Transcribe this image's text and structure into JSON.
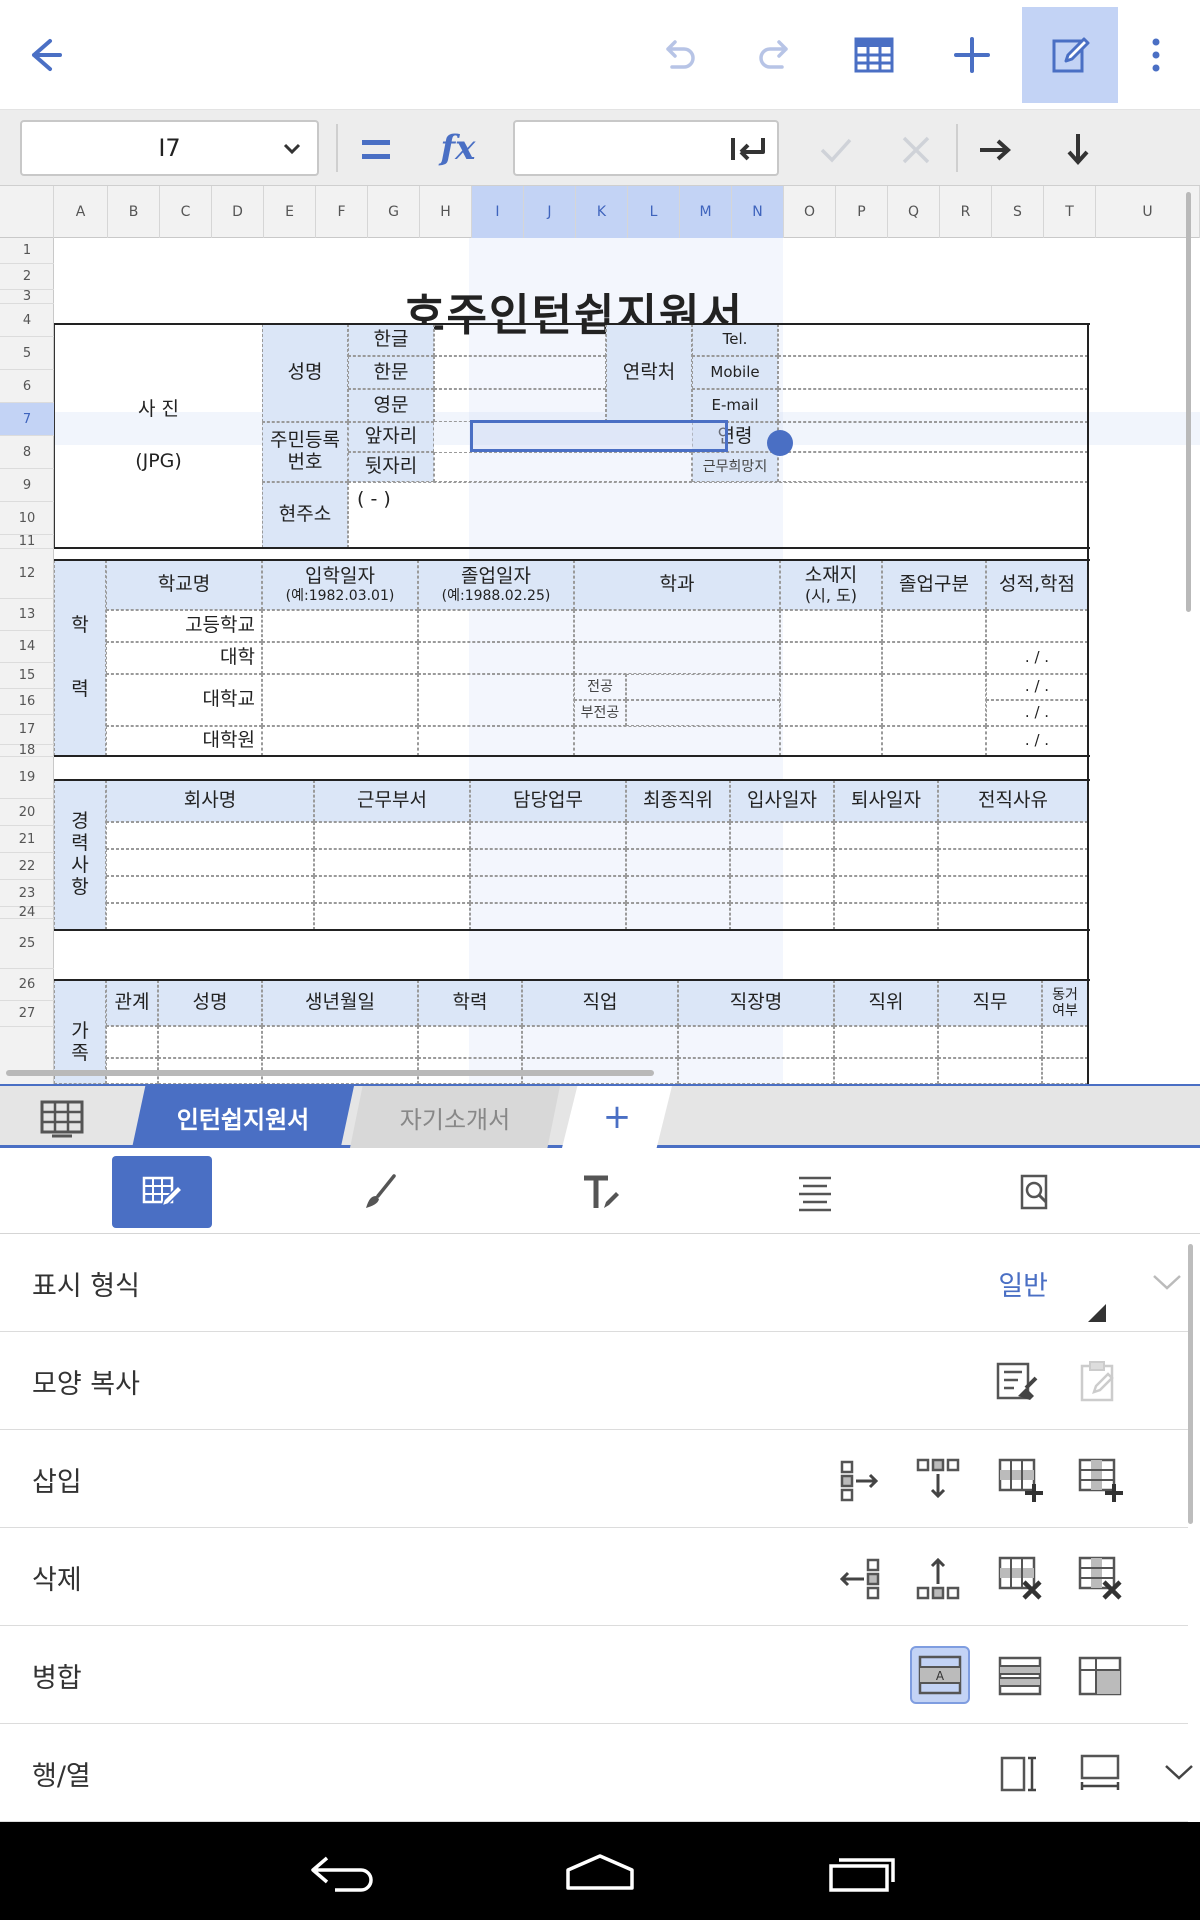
{
  "toolbar": {
    "back": "back-arrow-icon",
    "undo": "undo-icon",
    "redo": "redo-icon",
    "table": "table-icon",
    "add": "plus-icon",
    "edit": "edit-icon",
    "more": "more-vertical-icon",
    "accent": "#4a6fc4"
  },
  "formula_bar": {
    "cell_ref": "I7",
    "equals": "=",
    "fx": "fx",
    "formula_value": ""
  },
  "sheet": {
    "columns": [
      "A",
      "B",
      "C",
      "D",
      "E",
      "F",
      "G",
      "H",
      "I",
      "J",
      "K",
      "L",
      "M",
      "N",
      "O",
      "P",
      "Q",
      "R",
      "S",
      "T",
      "U"
    ],
    "selected_columns": [
      "I",
      "J",
      "K",
      "L",
      "M",
      "N"
    ],
    "rows": [
      "1",
      "2",
      "3",
      "4",
      "5",
      "6",
      "7",
      "8",
      "9",
      "10",
      "11",
      "12",
      "13",
      "14",
      "15",
      "16",
      "17",
      "18",
      "19",
      "20",
      "21",
      "22",
      "23",
      "24",
      "25",
      "26",
      "27"
    ],
    "selected_row": "7",
    "title": "호주인턴쉽지원서",
    "personal": {
      "photo": "사 진",
      "photo_format": "(JPG)",
      "name": "성명",
      "hangul": "한글",
      "hanja": "한문",
      "english": "영문",
      "contact": "연락처",
      "tel": "Tel.",
      "mobile": "Mobile",
      "email": "E-mail",
      "resident_no_1": "주민등록",
      "resident_no_2": "번호",
      "front": "앞자리",
      "back": "뒷자리",
      "age": "연령",
      "desired_area": "근무희망지",
      "address": "현주소",
      "address_fmt": "(        -        )"
    },
    "education": {
      "side_1": "학",
      "side_2": "력",
      "school": "학교명",
      "entry": "입학일자",
      "entry_ex": "(예:1982.03.01)",
      "grad": "졸업일자",
      "grad_ex": "(예:1988.02.25)",
      "major": "학과",
      "location": "소재지",
      "location_sub": "(시, 도)",
      "grad_type": "졸업구분",
      "grades": "성적,학점",
      "high": "고등학교",
      "college": "대학",
      "university": "대학교",
      "graduate": "대학원",
      "major_label": "전공",
      "minor_label": "부전공",
      "score_fmt": ".  /  ."
    },
    "career": {
      "side": "경력사항",
      "company": "회사명",
      "dept": "근무부서",
      "duty": "담당업무",
      "position": "최종직위",
      "join": "입사일자",
      "leave": "퇴사일자",
      "reason": "전직사유"
    },
    "family": {
      "side": "가족",
      "relation": "관계",
      "name": "성명",
      "birth": "생년월일",
      "edu": "학력",
      "job": "직업",
      "workplace": "직장명",
      "position": "직위",
      "duty": "직무",
      "living_1": "동거",
      "living_2": "여부"
    }
  },
  "tabs": {
    "sheets_icon": "sheet-list-icon",
    "items": [
      "인턴쉽지원서",
      "자기소개서"
    ],
    "active": "인턴쉽지원서",
    "add": "+"
  },
  "panel": {
    "tabs": [
      "cell-format-icon",
      "brush-icon",
      "text-format-icon",
      "align-icon",
      "find-icon"
    ],
    "rows": {
      "display_format": "표시 형식",
      "display_value": "일반",
      "format_copy": "모양 복사",
      "insert": "삽입",
      "delete": "삭제",
      "merge": "병합",
      "row_col": "행/열"
    }
  },
  "navbar": {
    "back": "nav-back-icon",
    "home": "nav-home-icon",
    "recent": "nav-recent-icon"
  }
}
